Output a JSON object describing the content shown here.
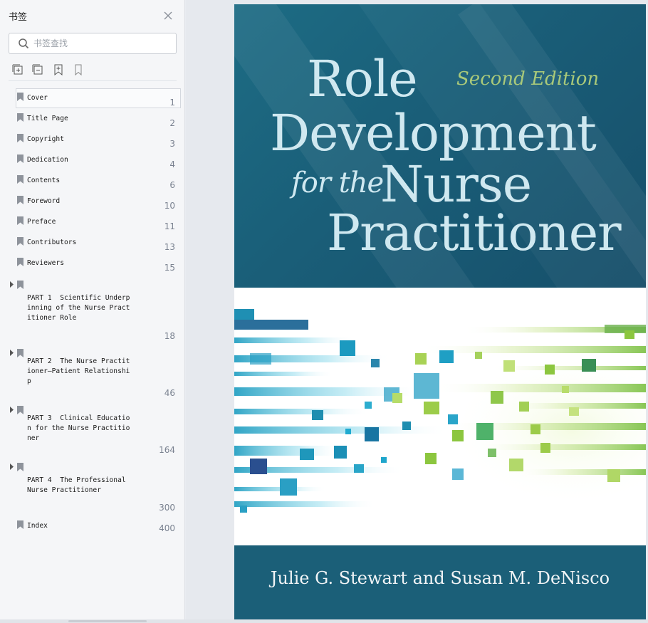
{
  "sidebar": {
    "title": "书签",
    "search_placeholder": "书签查找",
    "toolbar": [
      "expand-all-icon",
      "collapse-all-icon",
      "add-bookmark-icon",
      "bookmark-outline-icon"
    ],
    "bookmarks": [
      {
        "label": "Cover",
        "page": "1",
        "expandable": false,
        "selected": true
      },
      {
        "label": "Title Page",
        "page": "2",
        "expandable": false
      },
      {
        "label": "Copyright",
        "page": "3",
        "expandable": false
      },
      {
        "label": "Dedication",
        "page": "4",
        "expandable": false
      },
      {
        "label": "Contents",
        "page": "6",
        "expandable": false
      },
      {
        "label": "Foreword",
        "page": "10",
        "expandable": false
      },
      {
        "label": "Preface",
        "page": "11",
        "expandable": false
      },
      {
        "label": "Contributors",
        "page": "13",
        "expandable": false
      },
      {
        "label": "Reviewers",
        "page": "15",
        "expandable": false
      },
      {
        "label": "PART 1  Scientific Underpinning of the Nurse Practitioner Role",
        "page": "18",
        "expandable": true
      },
      {
        "label": "PART 2  The Nurse Practitioner—Patient Relationship",
        "page": "46",
        "expandable": true
      },
      {
        "label": "PART 3  Clinical Education for the Nurse Practitioner",
        "page": "164",
        "expandable": true
      },
      {
        "label": "PART 4  The Professional Nurse Practitioner",
        "page": "300",
        "expandable": true
      },
      {
        "label": "Index",
        "page": "400",
        "expandable": false
      }
    ]
  },
  "cover": {
    "title_line1": "Role",
    "title_line2": "Development",
    "title_line3a": "for the",
    "title_line3b": "Nurse",
    "title_line4": "Practitioner",
    "edition": "Second Edition",
    "authors": "Julie G. Stewart and Susan M. DeNisco",
    "colors": {
      "teal": "#1b5f78",
      "title": "#cfe8f0",
      "edition": "#a9c97a"
    }
  }
}
